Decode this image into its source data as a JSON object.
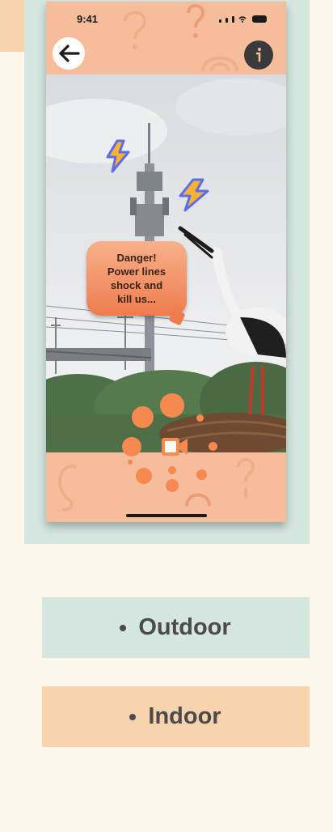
{
  "status_bar": {
    "time": "9:41"
  },
  "speech_bubble": {
    "text": "Danger!\nPower lines\nshock and\nkill us..."
  },
  "icons": {
    "back": "arrow-left-icon",
    "info": "info-icon",
    "lightning": "lightning-bolt-icon",
    "record": "video-camera-icon"
  },
  "colors": {
    "page_bg": "#fcf7ea",
    "mint": "#d4e6df",
    "peach": "#f7d3ae",
    "phone_peach": "#f6bd9c",
    "accent_orange": "#f5894f",
    "bolt_yellow": "#f9b233",
    "bolt_blue": "#5b6ee8"
  },
  "categories": [
    {
      "label": "Outdoor"
    },
    {
      "label": "Indoor"
    }
  ]
}
